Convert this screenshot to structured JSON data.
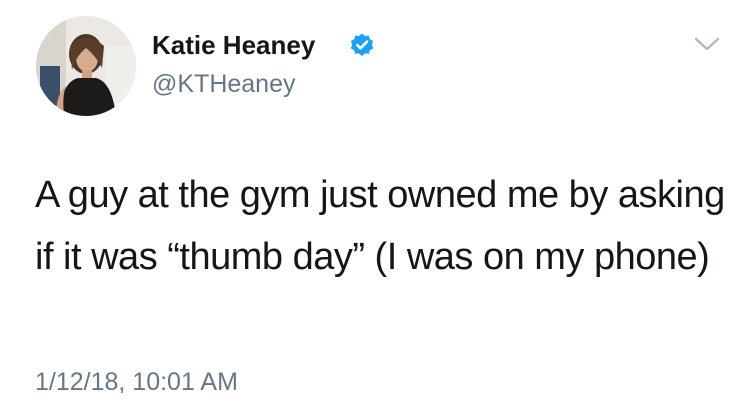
{
  "tweet": {
    "author": {
      "display_name": "Katie Heaney",
      "handle": "@KTHeaney",
      "verified": true,
      "verified_icon": "verified-badge-icon"
    },
    "text": "A guy at the gym just owned me by asking if it was “thumb day” (I was on my phone)",
    "timestamp": "1/12/18, 10:01 AM",
    "menu_icon": "chevron-down-icon"
  },
  "colors": {
    "primary_text": "#14171a",
    "secondary_text": "#657786",
    "verified_blue": "#1da1f2",
    "chevron": "#aab8c2",
    "background": "#ffffff"
  }
}
